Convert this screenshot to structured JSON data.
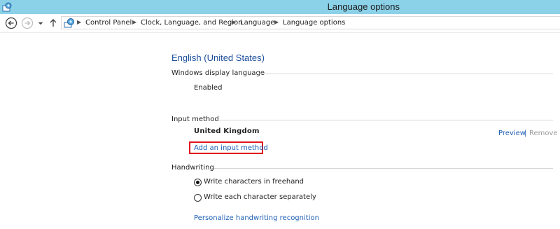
{
  "window": {
    "title": "Language options",
    "icon": "control-panel-icon"
  },
  "nav": {
    "back_icon": "back-arrow-icon",
    "forward_icon": "forward-arrow-icon",
    "dropdown_icon": "chevron-down-icon",
    "up_icon": "up-arrow-icon",
    "breadcrumb": [
      "Control Panel",
      "Clock, Language, and Region",
      "Language",
      "Language options"
    ]
  },
  "language": {
    "name": "English (United States)"
  },
  "display_language": {
    "heading": "Windows display language",
    "status": "Enabled"
  },
  "input_method": {
    "heading": "Input method",
    "keyboard": "United Kingdom",
    "preview_label": "Preview",
    "divider": "|",
    "remove_label": "Remove",
    "add_label": "Add an input method"
  },
  "handwriting": {
    "heading": "Handwriting",
    "options": [
      {
        "label": "Write characters in freehand",
        "selected": true
      },
      {
        "label": "Write each character separately",
        "selected": false
      }
    ],
    "personalize_label": "Personalize handwriting recognition"
  },
  "colors": {
    "accent_link": "#1d5fb4",
    "title_bar": "#8bd1e8",
    "highlight_box": "#e0161b",
    "heading_blue": "#1c4e9a"
  }
}
